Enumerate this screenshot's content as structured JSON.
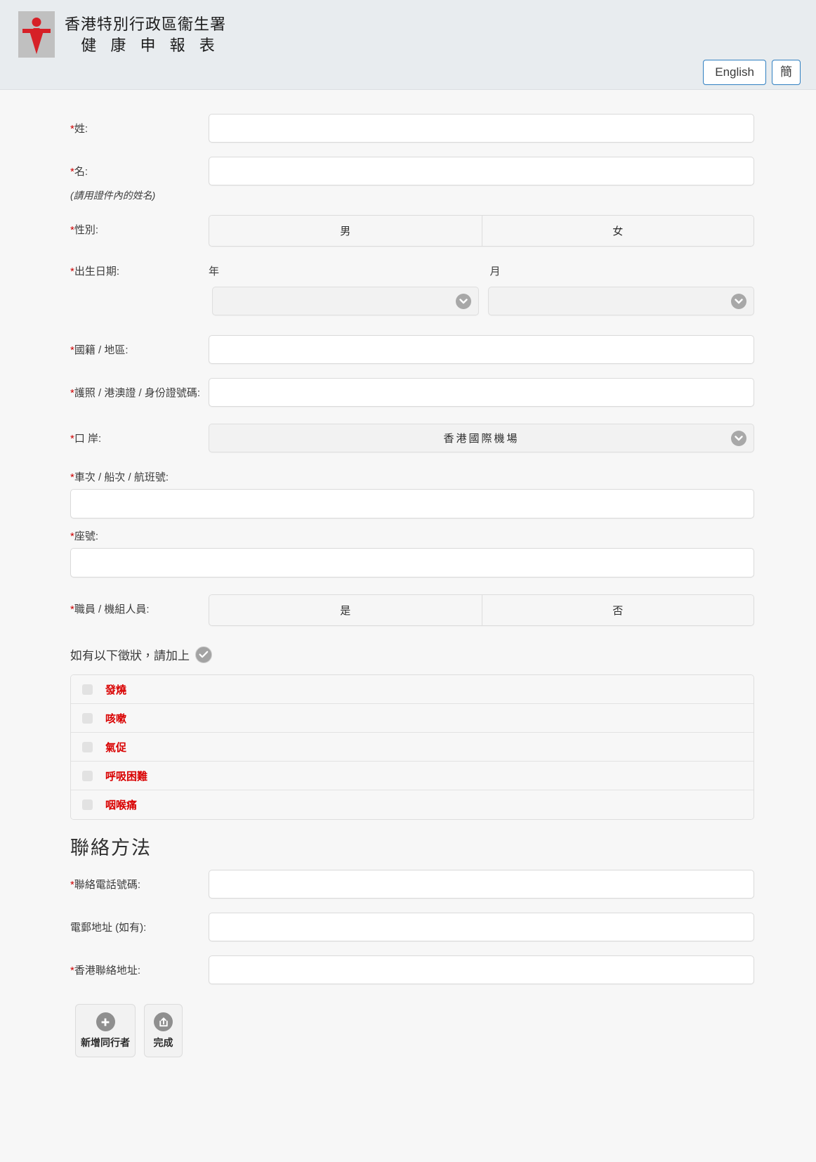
{
  "header": {
    "agency_line1": "香港特別行政區衞生署",
    "agency_line2": "健 康 申 報 表",
    "logo_alt": "health-department-logo",
    "lang_english": "English",
    "lang_simplified": "簡"
  },
  "form": {
    "surname_label": "*姓:",
    "given_name_label": "*名:",
    "name_note": "(請用證件內的姓名)",
    "sex_label": "*性別:",
    "sex_options": [
      "男",
      "女"
    ],
    "dob_label": "*出生日期:",
    "dob_year_header": "年",
    "dob_month_header": "月",
    "dob_year_value": "",
    "dob_month_value": "",
    "nationality_label": "*國籍 / 地區:",
    "document_label": "*護照 / 港澳證 / 身份證號碼:",
    "port_label": "*口 岸:",
    "port_value": "香港國際機場",
    "flight_label": "*車次 / 船次 / 航班號:",
    "seat_label": "*座號:",
    "crew_label": "*職員 / 機組人員:",
    "crew_options": [
      "是",
      "否"
    ],
    "surname_value": "",
    "given_name_value": "",
    "nationality_value": "",
    "document_value": "",
    "flight_value": "",
    "seat_value": ""
  },
  "symptoms": {
    "prompt": "如有以下徵狀，請加上",
    "check_icon": "check-circle-icon",
    "items": [
      {
        "label": "發燒",
        "checked": false
      },
      {
        "label": "咳嗽",
        "checked": false
      },
      {
        "label": "氣促",
        "checked": false
      },
      {
        "label": "呼吸困難",
        "checked": false
      },
      {
        "label": "咽喉痛",
        "checked": false
      }
    ]
  },
  "contact": {
    "section_title": "聯絡方法",
    "phone_label": "*聯絡電話號碼:",
    "phone_value": "",
    "email_label": "電郵地址 (如有):",
    "email_value": "",
    "address_label": "*香港聯絡地址:",
    "address_value": ""
  },
  "actions": {
    "add_companion_label": "新增同行者",
    "add_companion_icon": "plus-circle-icon",
    "finish_label": "完成",
    "finish_icon": "share-export-icon"
  },
  "colors": {
    "required_red": "#cc0000",
    "symptom_red": "#d90000",
    "header_bg": "#e8ecef",
    "lang_border_blue": "#2f7fc1",
    "logo_red": "#d62027"
  }
}
